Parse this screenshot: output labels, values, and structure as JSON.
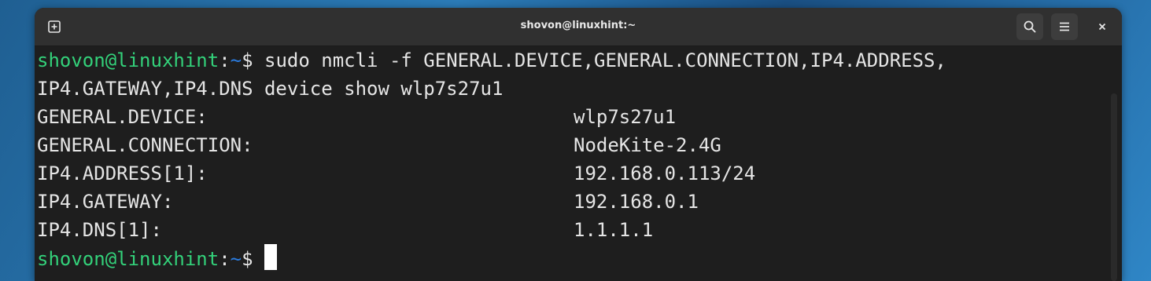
{
  "window": {
    "title": "shovon@linuxhint:~"
  },
  "toolbar": {
    "new_tab_icon": "new-tab-icon",
    "search_icon": "search-icon",
    "menu_icon": "hamburger-menu-icon",
    "close_label": "×"
  },
  "terminal": {
    "prompt_user": "shovon@linuxhint",
    "prompt_sep": ":",
    "prompt_path": "~",
    "prompt_sign": "$ ",
    "command_line1": "sudo nmcli -f GENERAL.DEVICE,GENERAL.CONNECTION,IP4.ADDRESS,",
    "command_line2": "IP4.GATEWAY,IP4.DNS device show wlp7s27u1",
    "output": [
      {
        "key": "GENERAL.DEVICE:",
        "value": "wlp7s27u1"
      },
      {
        "key": "GENERAL.CONNECTION:",
        "value": "NodeKite-2.4G"
      },
      {
        "key": "IP4.ADDRESS[1]:",
        "value": "192.168.0.113/24"
      },
      {
        "key": "IP4.GATEWAY:",
        "value": "192.168.0.1"
      },
      {
        "key": "IP4.DNS[1]:",
        "value": "1.1.1.1"
      }
    ]
  },
  "colors": {
    "prompt_user": "#33d17a",
    "prompt_path": "#2a7bde",
    "background": "#1e1e1e"
  }
}
